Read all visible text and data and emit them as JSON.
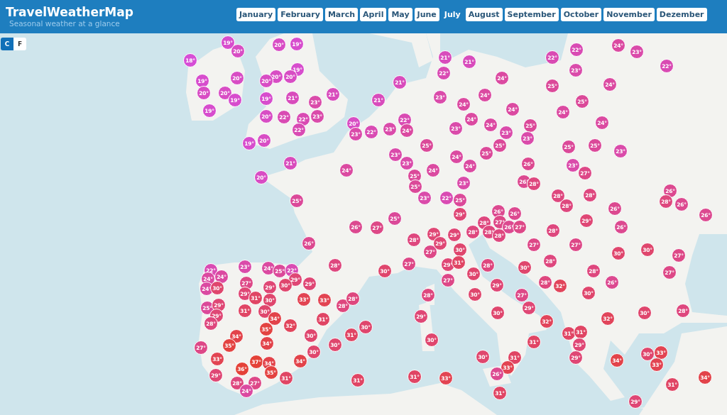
{
  "header": {
    "title": "TravelWeatherMap",
    "subtitle": "Seasonal weather at a glance"
  },
  "months": [
    {
      "label": "January",
      "selected": false
    },
    {
      "label": "February",
      "selected": false
    },
    {
      "label": "March",
      "selected": false
    },
    {
      "label": "April",
      "selected": false
    },
    {
      "label": "May",
      "selected": false
    },
    {
      "label": "June",
      "selected": false
    },
    {
      "label": "July",
      "selected": true
    },
    {
      "label": "August",
      "selected": false
    },
    {
      "label": "September",
      "selected": false
    },
    {
      "label": "October",
      "selected": false
    },
    {
      "label": "November",
      "selected": false
    },
    {
      "label": "Dezember",
      "selected": false
    }
  ],
  "units": [
    {
      "label": "C",
      "selected": true
    },
    {
      "label": "F",
      "selected": false
    }
  ],
  "markers": [
    "18°",
    "19°",
    "20°",
    "19°",
    "20°",
    "20°",
    "20°",
    "19°",
    "19°",
    "20°",
    "19°",
    "19°",
    "20°",
    "20°",
    "20°",
    "19°",
    "21°",
    "23°",
    "21°",
    "20°",
    "22°",
    "22°",
    "23°",
    "22°",
    "19°",
    "20°",
    "21°",
    "20°",
    "25°",
    "24°",
    "21°",
    "21°",
    "20°",
    "23°",
    "22°",
    "23°",
    "22°",
    "24°",
    "25°",
    "23°",
    "23°",
    "24°",
    "25°",
    "25°",
    "23°",
    "25°",
    "26°",
    "27°",
    "26°",
    "21°",
    "21°",
    "22°",
    "22°",
    "22°",
    "23°",
    "24°",
    "23°",
    "22°",
    "24°",
    "25°",
    "24°",
    "23°",
    "24°",
    "24°",
    "25°",
    "24°",
    "24°",
    "24°",
    "23°",
    "24°",
    "25°",
    "23°",
    "24°",
    "23°",
    "25°",
    "25°",
    "23°",
    "25°",
    "25°",
    "24°",
    "24°",
    "26°",
    "23°",
    "27°",
    "23°",
    "26°",
    "28°",
    "22°",
    "25°",
    "29°",
    "28°",
    "28°",
    "28°",
    "26°",
    "26°",
    "26°",
    "27°",
    "26°",
    "27°",
    "28°",
    "28°",
    "28°",
    "28°",
    "29°",
    "26°",
    "26°",
    "28°",
    "26°",
    "26°",
    "22°",
    "23°",
    "24°",
    "24°",
    "27°",
    "24°",
    "30°",
    "24°",
    "25°",
    "22°",
    "29°",
    "30°",
    "29°",
    "28°",
    "29°",
    "31°",
    "29°",
    "30°",
    "33°",
    "33°",
    "28°",
    "28°",
    "25°",
    "29°",
    "29°",
    "28°",
    "31°",
    "30°",
    "34°",
    "35°",
    "32°",
    "31°",
    "30°",
    "31°",
    "30°",
    "30°",
    "34°",
    "35°",
    "34°",
    "27°",
    "33°",
    "37°",
    "34°",
    "30°",
    "34°",
    "36°",
    "35°",
    "29°",
    "31°",
    "28°",
    "27°",
    "24°",
    "31°",
    "31°",
    "29°",
    "28°",
    "30°",
    "28°",
    "27°",
    "29°",
    "29°",
    "29°",
    "28°",
    "30°",
    "27°",
    "29°",
    "31°",
    "30°",
    "28°",
    "30°",
    "27°",
    "30°",
    "29°",
    "27°",
    "29°",
    "30°",
    "27°",
    "30°",
    "28°",
    "28°",
    "32°",
    "27°",
    "28°",
    "26°",
    "30°",
    "30°",
    "30°",
    "27°",
    "27°",
    "28°",
    "30°",
    "32°",
    "32°",
    "31°",
    "31°",
    "29°",
    "29°",
    "31°",
    "30°",
    "31°",
    "33°",
    "26°",
    "31°",
    "33°",
    "34°",
    "30°",
    "33°",
    "33°",
    "31°",
    "34°",
    "29°"
  ]
}
